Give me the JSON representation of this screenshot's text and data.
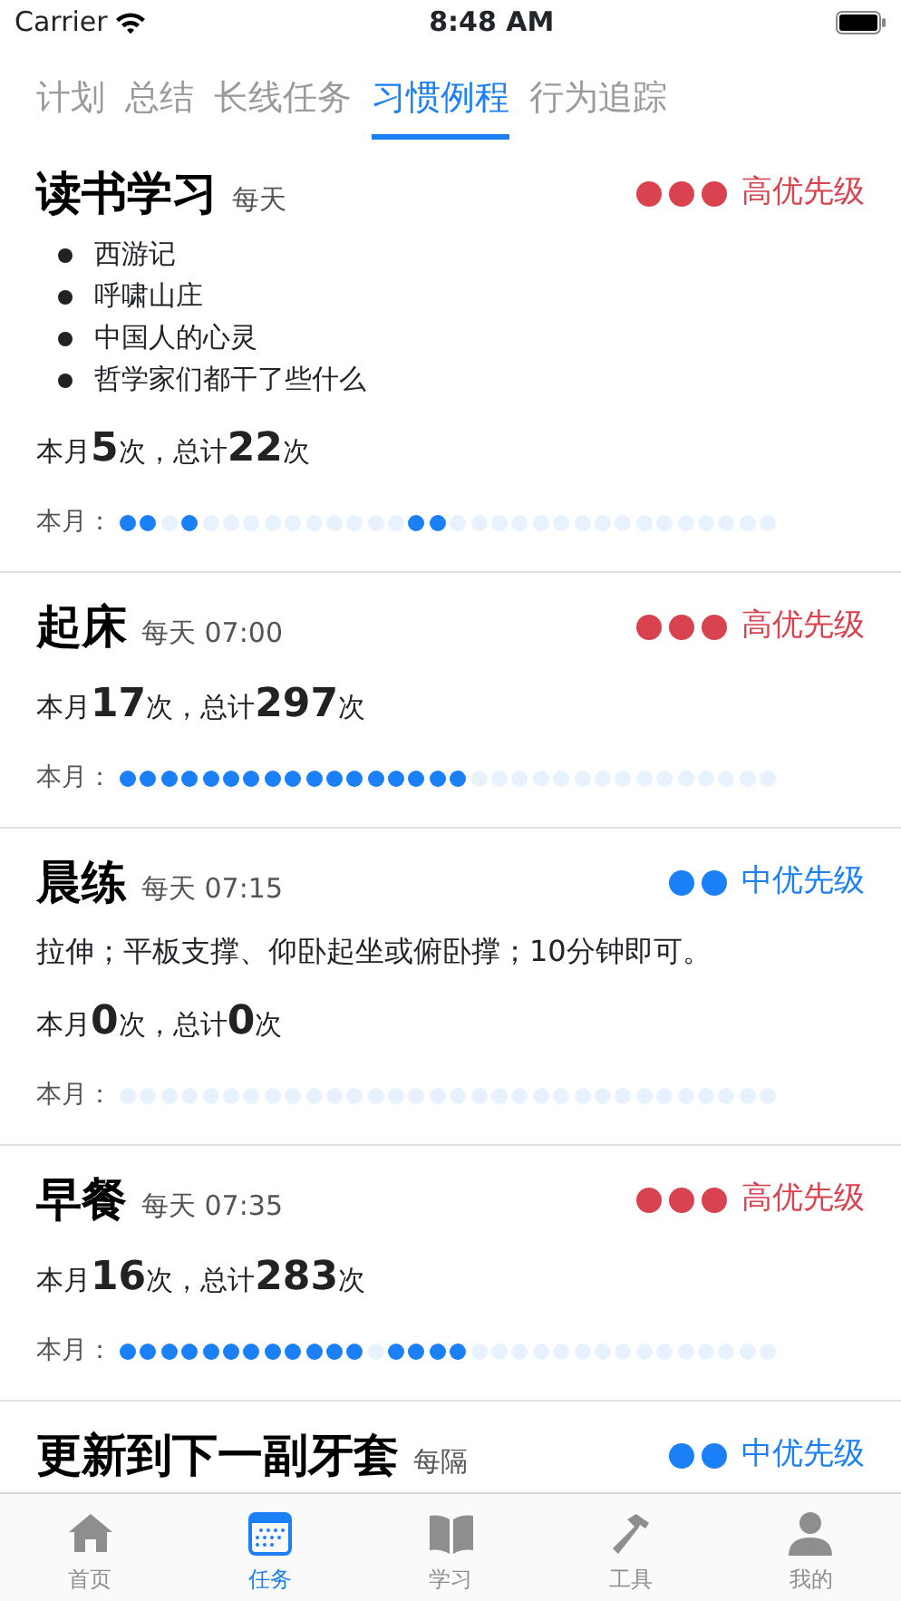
{
  "status_bar": {
    "carrier": "Carrier",
    "time": "8:48 AM"
  },
  "tabs": [
    {
      "label": "计划",
      "selected": false
    },
    {
      "label": "总结",
      "selected": false
    },
    {
      "label": "长线任务",
      "selected": false
    },
    {
      "label": "习惯例程",
      "selected": true
    },
    {
      "label": "行为追踪",
      "selected": false
    }
  ],
  "cards": [
    {
      "title": "读书学习",
      "schedule": "每天",
      "priority": {
        "kind": "high",
        "label": "高优先级"
      },
      "items": [
        "西游记",
        "呼啸山庄",
        "中国人的心灵",
        "哲学家们都干了些什么"
      ],
      "stats": {
        "month_prefix": "本月",
        "month_count": "5",
        "month_suffix": "次，总计",
        "total": "22",
        "total_suffix": "次"
      },
      "track_label": "本月：",
      "days": [
        true,
        true,
        false,
        true,
        false,
        false,
        false,
        false,
        false,
        false,
        false,
        false,
        false,
        false,
        true,
        true,
        false,
        false,
        false,
        false,
        false,
        false,
        false,
        false,
        false,
        false,
        false,
        false,
        false,
        false,
        false,
        false
      ]
    },
    {
      "title": "起床",
      "schedule": "每天 07:00",
      "priority": {
        "kind": "high",
        "label": "高优先级"
      },
      "stats": {
        "month_prefix": "本月",
        "month_count": "17",
        "month_suffix": "次，总计",
        "total": "297",
        "total_suffix": "次"
      },
      "track_label": "本月：",
      "days": [
        true,
        true,
        true,
        true,
        true,
        true,
        true,
        true,
        true,
        true,
        true,
        true,
        true,
        true,
        true,
        true,
        true,
        false,
        false,
        false,
        false,
        false,
        false,
        false,
        false,
        false,
        false,
        false,
        false,
        false,
        false,
        false
      ]
    },
    {
      "title": "晨练",
      "schedule": "每天 07:15",
      "priority": {
        "kind": "medium",
        "label": "中优先级"
      },
      "note": "拉伸；平板支撑、仰卧起坐或俯卧撑；10分钟即可。",
      "stats": {
        "month_prefix": "本月",
        "month_count": "0",
        "month_suffix": "次，总计",
        "total": "0",
        "total_suffix": "次"
      },
      "track_label": "本月：",
      "days": [
        false,
        false,
        false,
        false,
        false,
        false,
        false,
        false,
        false,
        false,
        false,
        false,
        false,
        false,
        false,
        false,
        false,
        false,
        false,
        false,
        false,
        false,
        false,
        false,
        false,
        false,
        false,
        false,
        false,
        false,
        false,
        false
      ]
    },
    {
      "title": "早餐",
      "schedule": "每天 07:35",
      "priority": {
        "kind": "high",
        "label": "高优先级"
      },
      "stats": {
        "month_prefix": "本月",
        "month_count": "16",
        "month_suffix": "次，总计",
        "total": "283",
        "total_suffix": "次"
      },
      "track_label": "本月：",
      "days": [
        true,
        true,
        true,
        true,
        true,
        true,
        true,
        true,
        true,
        true,
        true,
        true,
        false,
        true,
        true,
        true,
        true,
        false,
        false,
        false,
        false,
        false,
        false,
        false,
        false,
        false,
        false,
        false,
        false,
        false,
        false,
        false
      ]
    },
    {
      "title": "更新到下一副牙套",
      "schedule": "每隔",
      "priority": {
        "kind": "medium",
        "label": "中优先级"
      }
    }
  ],
  "bottom_tabs": [
    {
      "label": "首页",
      "kind": "home",
      "selected": false
    },
    {
      "label": "任务",
      "kind": "calendar",
      "selected": true
    },
    {
      "label": "学习",
      "kind": "book",
      "selected": false
    },
    {
      "label": "工具",
      "kind": "hammer",
      "selected": false
    },
    {
      "label": "我的",
      "kind": "person",
      "selected": false
    }
  ]
}
